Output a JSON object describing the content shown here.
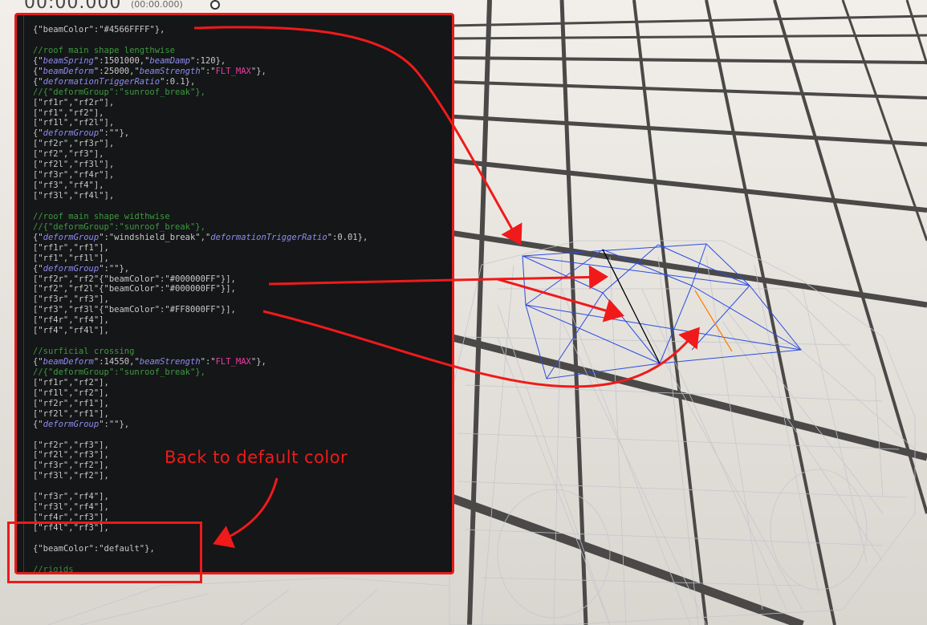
{
  "timeline": {
    "time_main": "00:00.000",
    "time_sub": "(00:00.000)"
  },
  "annotation": {
    "callout_text": "Back to default color",
    "arrow_color": "#f01a1a"
  },
  "colors": {
    "panel_background": "#141618",
    "comment": "#3e9a3e",
    "italic_key": "#8f8cf0",
    "flt_max": "#ef3aa6",
    "wireframe_highlight": "#2b4ce0",
    "orange_beam": "#ff8000"
  },
  "code": {
    "lines": [
      [
        [
          "p",
          "{\""
        ],
        [
          "k",
          "beamColor"
        ],
        [
          "p",
          "\":\""
        ],
        [
          "k",
          "#4566FFFF"
        ],
        [
          "p",
          "\"},"
        ]
      ],
      [],
      [
        [
          "c",
          "//roof main shape lengthwise"
        ]
      ],
      [
        [
          "p",
          "{\""
        ],
        [
          "ki",
          "beamSpring"
        ],
        [
          "p",
          "\":1501000,\""
        ],
        [
          "ki",
          "beamDamp"
        ],
        [
          "p",
          "\":120},"
        ]
      ],
      [
        [
          "p",
          "{\""
        ],
        [
          "ki",
          "beamDeform"
        ],
        [
          "p",
          "\":25000,\""
        ],
        [
          "ki",
          "beamStrength"
        ],
        [
          "p",
          "\":\""
        ],
        [
          "mag",
          "FLT_MAX"
        ],
        [
          "p",
          "\"},"
        ]
      ],
      [
        [
          "p",
          "{\""
        ],
        [
          "ki",
          "deformationTriggerRatio"
        ],
        [
          "p",
          "\":0.1},"
        ]
      ],
      [
        [
          "c",
          "//{\"deformGroup\":\"sunroof_break\"},"
        ]
      ],
      [
        [
          "p",
          "[\"rf1r\",\"rf2r\"],"
        ]
      ],
      [
        [
          "p",
          "[\"rf1\",\"rf2\"],"
        ]
      ],
      [
        [
          "p",
          "[\"rf1l\",\"rf2l\"],"
        ]
      ],
      [
        [
          "p",
          "{\""
        ],
        [
          "ki",
          "deformGroup"
        ],
        [
          "p",
          "\":\"\"},"
        ]
      ],
      [
        [
          "p",
          "[\"rf2r\",\"rf3r\"],"
        ]
      ],
      [
        [
          "p",
          "[\"rf2\",\"rf3\"],"
        ]
      ],
      [
        [
          "p",
          "[\"rf2l\",\"rf3l\"],"
        ]
      ],
      [
        [
          "p",
          "[\"rf3r\",\"rf4r\"],"
        ]
      ],
      [
        [
          "p",
          "[\"rf3\",\"rf4\"],"
        ]
      ],
      [
        [
          "p",
          "[\"rf3l\",\"rf4l\"],"
        ]
      ],
      [],
      [
        [
          "c",
          "//roof main shape widthwise"
        ]
      ],
      [
        [
          "c",
          "//{\"deformGroup\":\"sunroof_break\"},"
        ]
      ],
      [
        [
          "p",
          "{\""
        ],
        [
          "ki",
          "deformGroup"
        ],
        [
          "p",
          "\":\"windshield_break\",\""
        ],
        [
          "ki",
          "deformationTriggerRatio"
        ],
        [
          "p",
          "\":0.01},"
        ]
      ],
      [
        [
          "p",
          "[\"rf1r\",\"rf1\"],"
        ]
      ],
      [
        [
          "p",
          "[\"rf1\",\"rf1l\"],"
        ]
      ],
      [
        [
          "p",
          "{\""
        ],
        [
          "ki",
          "deformGroup"
        ],
        [
          "p",
          "\":\"\"},"
        ]
      ],
      [
        [
          "p",
          "[\"rf2r\",\"rf2\"{\"beamColor\":\"#000000FF\"}],"
        ]
      ],
      [
        [
          "p",
          "[\"rf2\",\"rf2l\"{\"beamColor\":\"#000000FF\"}],"
        ]
      ],
      [
        [
          "p",
          "[\"rf3r\",\"rf3\"],"
        ]
      ],
      [
        [
          "p",
          "[\"rf3\",\"rf3l\"{\"beamColor\":\"#FF8000FF\"}],"
        ]
      ],
      [
        [
          "p",
          "[\"rf4r\",\"rf4\"],"
        ]
      ],
      [
        [
          "p",
          "[\"rf4\",\"rf4l\"],"
        ]
      ],
      [],
      [
        [
          "c",
          "//surficial crossing"
        ]
      ],
      [
        [
          "p",
          "{\""
        ],
        [
          "ki",
          "beamDeform"
        ],
        [
          "p",
          "\":14550,\""
        ],
        [
          "ki",
          "beamStrength"
        ],
        [
          "p",
          "\":\""
        ],
        [
          "mag",
          "FLT_MAX"
        ],
        [
          "p",
          "\"},"
        ]
      ],
      [
        [
          "c",
          "//{\"deformGroup\":\"sunroof_break\"},"
        ]
      ],
      [
        [
          "p",
          "[\"rf1r\",\"rf2\"],"
        ]
      ],
      [
        [
          "p",
          "[\"rf1l\",\"rf2\"],"
        ]
      ],
      [
        [
          "p",
          "[\"rf2r\",\"rf1\"],"
        ]
      ],
      [
        [
          "p",
          "[\"rf2l\",\"rf1\"],"
        ]
      ],
      [
        [
          "p",
          "{\""
        ],
        [
          "ki",
          "deformGroup"
        ],
        [
          "p",
          "\":\"\"},"
        ]
      ],
      [],
      [
        [
          "p",
          "[\"rf2r\",\"rf3\"],"
        ]
      ],
      [
        [
          "p",
          "[\"rf2l\",\"rf3\"],"
        ]
      ],
      [
        [
          "p",
          "[\"rf3r\",\"rf2\"],"
        ]
      ],
      [
        [
          "p",
          "[\"rf3l\",\"rf2\"],"
        ]
      ],
      [],
      [
        [
          "p",
          "[\"rf3r\",\"rf4\"],"
        ]
      ],
      [
        [
          "p",
          "[\"rf3l\",\"rf4\"],"
        ]
      ],
      [
        [
          "p",
          "[\"rf4r\",\"rf3\"],"
        ]
      ],
      [
        [
          "p",
          "[\"rf4l\",\"rf3\"],"
        ]
      ],
      [],
      [
        [
          "p",
          "{\""
        ],
        [
          "k",
          "beamColor"
        ],
        [
          "p",
          "\":\""
        ],
        [
          "k",
          "default"
        ],
        [
          "p",
          "\"},"
        ]
      ],
      [],
      [
        [
          "cd",
          "//rigids"
        ]
      ]
    ]
  }
}
